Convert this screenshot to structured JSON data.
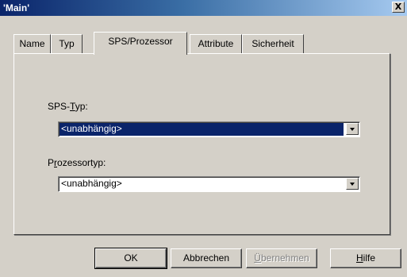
{
  "window": {
    "title": "'Main'",
    "close_glyph": "X"
  },
  "tabs": [
    {
      "label": "Name"
    },
    {
      "label": "Typ"
    },
    {
      "label": "SPS/Prozessor",
      "active": true
    },
    {
      "label": "Attribute"
    },
    {
      "label": "Sicherheit"
    }
  ],
  "fields": {
    "sps_typ": {
      "label_pre": "SPS-",
      "label_mnemonic": "T",
      "label_post": "yp:",
      "value": "<unabhängig>"
    },
    "prozessortyp": {
      "label_pre": "P",
      "label_mnemonic": "r",
      "label_post": "ozessortyp:",
      "value": "<unabhängig>"
    }
  },
  "buttons": {
    "ok": "OK",
    "cancel": "Abbrechen",
    "apply_mnemonic": "Ü",
    "apply_rest": "bernehmen",
    "help_mnemonic": "H",
    "help_rest": "ilfe"
  },
  "colors": {
    "titlebar_start": "#0a246a",
    "titlebar_end": "#a6caf0",
    "face": "#d4d0c8",
    "selection": "#0a246a"
  }
}
